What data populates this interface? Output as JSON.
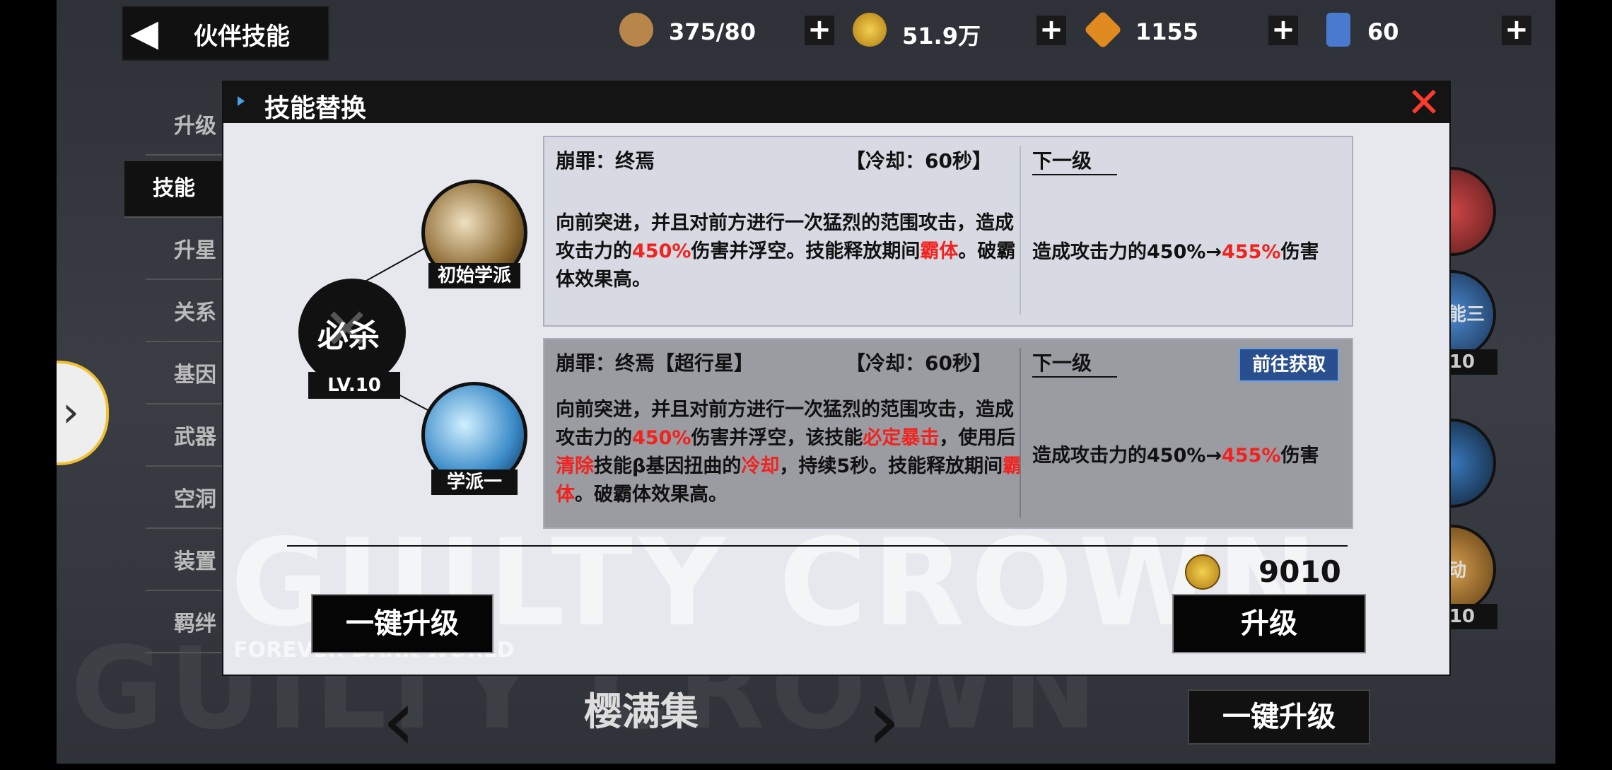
{
  "header": {
    "back_icon": "◀",
    "title": "伙伴技能"
  },
  "resources": [
    {
      "name": "stamina",
      "value": "375/80",
      "icon": "coffee-cup-icon",
      "color": "#b8864a"
    },
    {
      "name": "gold",
      "value": "51.9万",
      "icon": "gold-coin-icon",
      "color": "#e0b020"
    },
    {
      "name": "diamond",
      "value": "1155",
      "icon": "diamond-icon",
      "color": "#e08a20"
    },
    {
      "name": "ticket",
      "value": "60",
      "icon": "ticket-icon",
      "color": "#4a7ad0"
    }
  ],
  "plus_label": "+",
  "side_tabs": [
    "升级",
    "技能",
    "升星",
    "关系",
    "基因",
    "武器",
    "空洞",
    "装置",
    "羁绊"
  ],
  "right_badges": [
    "能三",
    ".10",
    "动",
    ".10"
  ],
  "bottom": {
    "char_name": "樱满集",
    "one_click": "一键升级"
  },
  "watermark": {
    "line1": "GUILTY CROWN",
    "line2": "FOREVER DARK WORLD"
  },
  "dialog": {
    "title": "技能替换",
    "close": "✕",
    "root": {
      "label": "必杀",
      "level": "LV.10"
    },
    "branches": [
      "初始学派",
      "学派一"
    ],
    "cards": [
      {
        "name": "崩罪：终焉",
        "cooldown": "【冷却：60秒】",
        "next_label": "下一级",
        "desc_parts": [
          {
            "t": "向前突进，并且对前方进行一次猛烈的范围攻击，造成攻击力的",
            "red": false
          },
          {
            "t": "450%",
            "red": true
          },
          {
            "t": "伤害并浮空。技能释放期间",
            "red": false
          },
          {
            "t": "霸体",
            "red": true
          },
          {
            "t": "。破霸体效果高。",
            "red": false
          }
        ],
        "next_effect": {
          "a": "造成攻击力的450%→",
          "b": "455%",
          "c": "伤害"
        }
      },
      {
        "name": "崩罪：终焉【超行星】",
        "cooldown": "【冷却：60秒】",
        "next_label": "下一级",
        "get_button": "前往获取",
        "desc_parts": [
          {
            "t": "向前突进，并且对前方进行一次猛烈的范围攻击，造成攻击力的",
            "red": false
          },
          {
            "t": "450%",
            "red": true
          },
          {
            "t": "伤害并浮空，该技能",
            "red": false
          },
          {
            "t": "必定暴击",
            "red": true
          },
          {
            "t": "，使用后",
            "red": false
          },
          {
            "t": "清除",
            "red": true
          },
          {
            "t": "技能β基因扭曲的",
            "red": false
          },
          {
            "t": "冷却",
            "red": true
          },
          {
            "t": "，持续5秒。技能释放期间",
            "red": false
          },
          {
            "t": "霸体",
            "red": true
          },
          {
            "t": "。破霸体效果高。",
            "red": false
          }
        ],
        "next_effect": {
          "a": "造成攻击力的450%→",
          "b": "455%",
          "c": "伤害"
        }
      }
    ],
    "cost": "9010",
    "one_click_button": "一键升级",
    "upgrade_button": "升级"
  }
}
